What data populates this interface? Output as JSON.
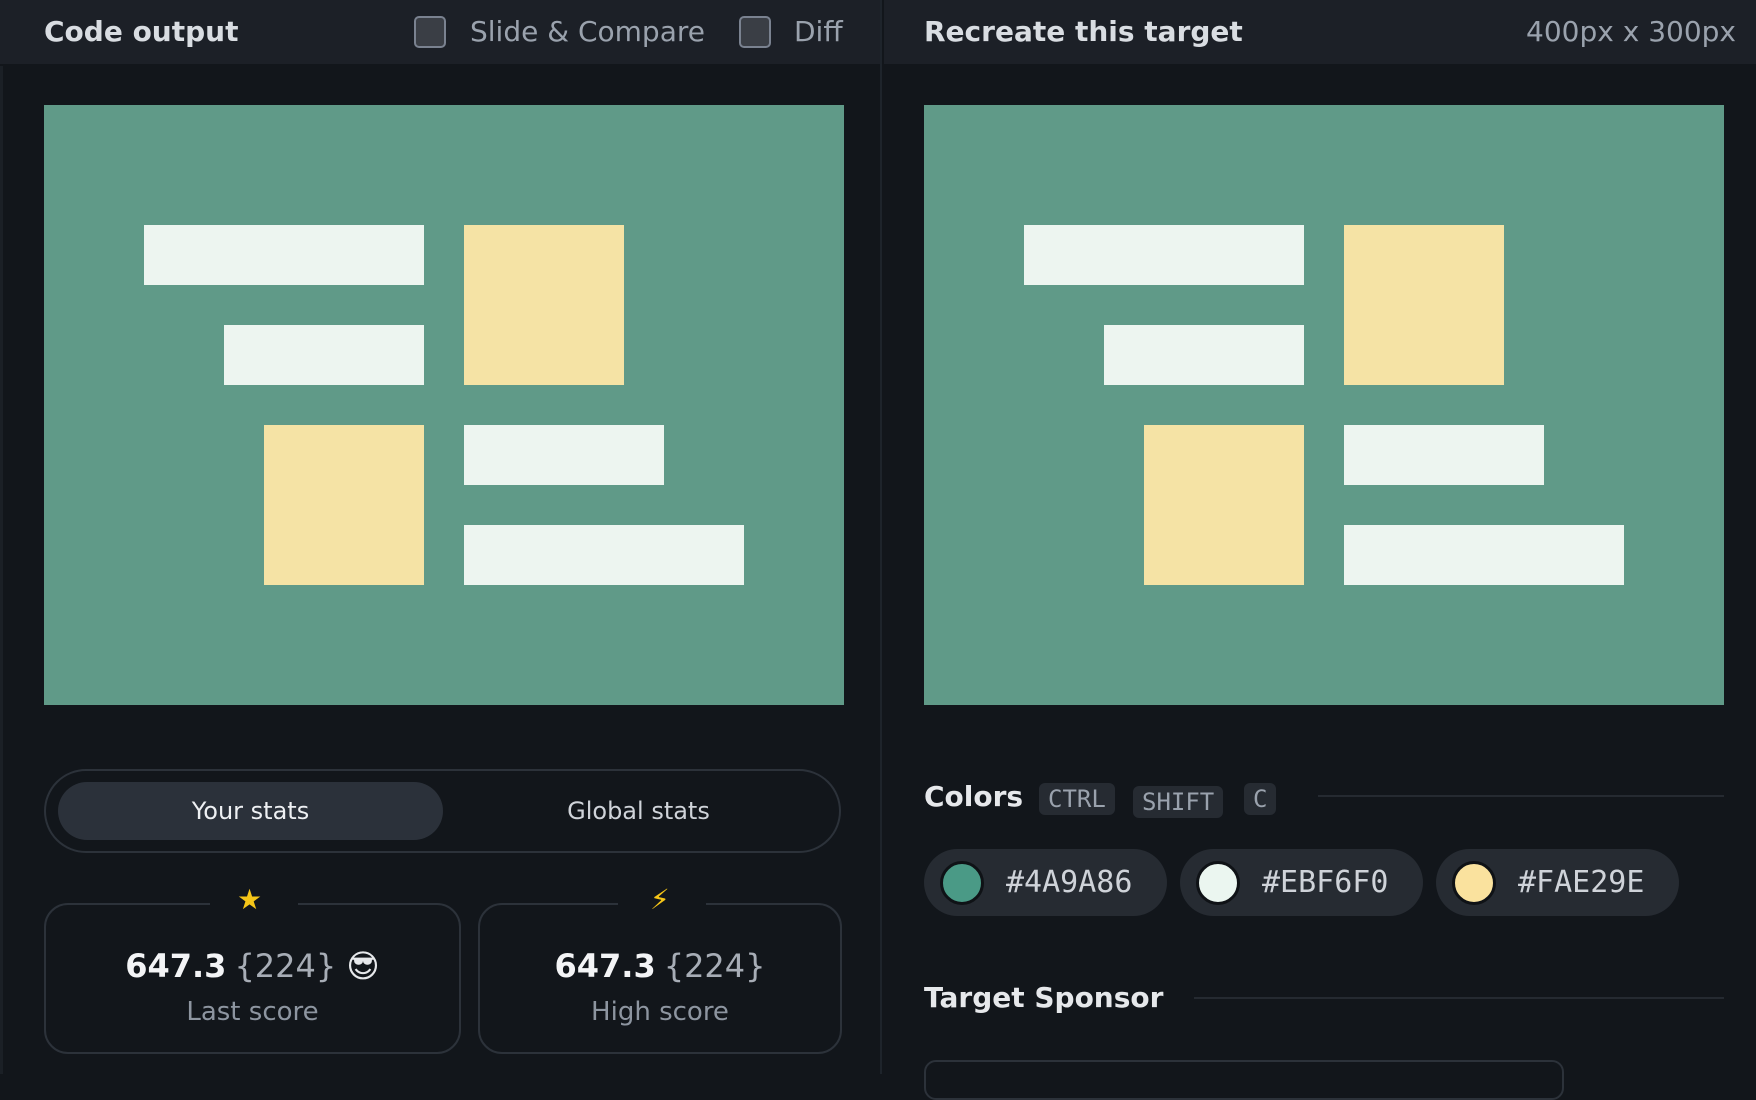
{
  "left_panel": {
    "title": "Code output",
    "slide_compare_label": "Slide & Compare",
    "diff_label": "Diff",
    "tabs": {
      "active": "Your stats",
      "inactive": "Global stats"
    },
    "last_score": {
      "value": "647.3",
      "attempts": "{224}",
      "emoji": "😎",
      "label": "Last score",
      "icon": "star-icon"
    },
    "high_score": {
      "value": "647.3",
      "attempts": "{224}",
      "label": "High score",
      "icon": "lightning-icon"
    }
  },
  "right_panel": {
    "title": "Recreate this target",
    "dimensions": "400px x 300px",
    "colors_heading": "Colors",
    "shortcut_keys": [
      "CTRL",
      "SHIFT",
      "C"
    ],
    "colors": [
      "#4A9A86",
      "#EBF6F0",
      "#FAE29E"
    ],
    "sponsor_heading": "Target Sponsor"
  },
  "canvas_colors": {
    "background": "#609A88",
    "light": "#EDF5F0",
    "accent": "#F5E3A5"
  }
}
